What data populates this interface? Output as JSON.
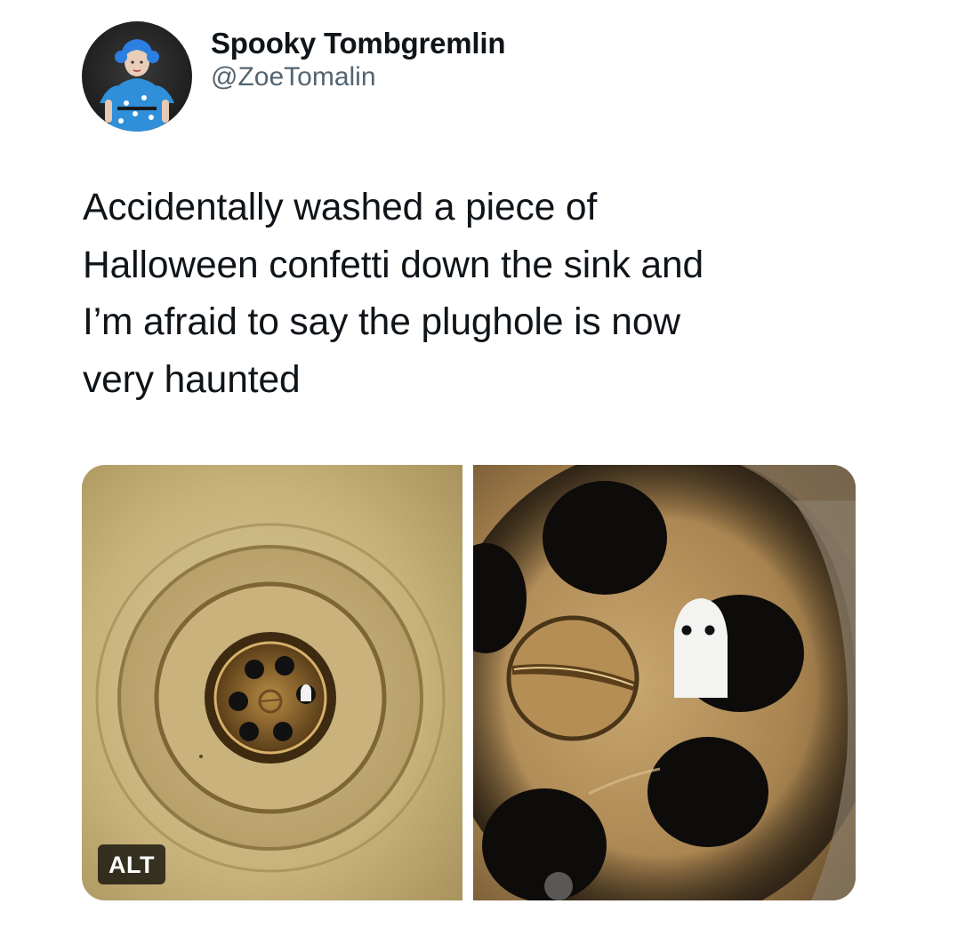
{
  "tweet": {
    "display_name": "Spooky Tombgremlin",
    "handle": "@ZoeTomalin",
    "text": "Accidentally washed a piece of\nHalloween confetti down the sink and\nI’m afraid to say the plughole is now\nvery haunted"
  },
  "media": {
    "alt_label": "ALT"
  },
  "colors": {
    "text": "#0f1419",
    "secondary": "#536471"
  }
}
